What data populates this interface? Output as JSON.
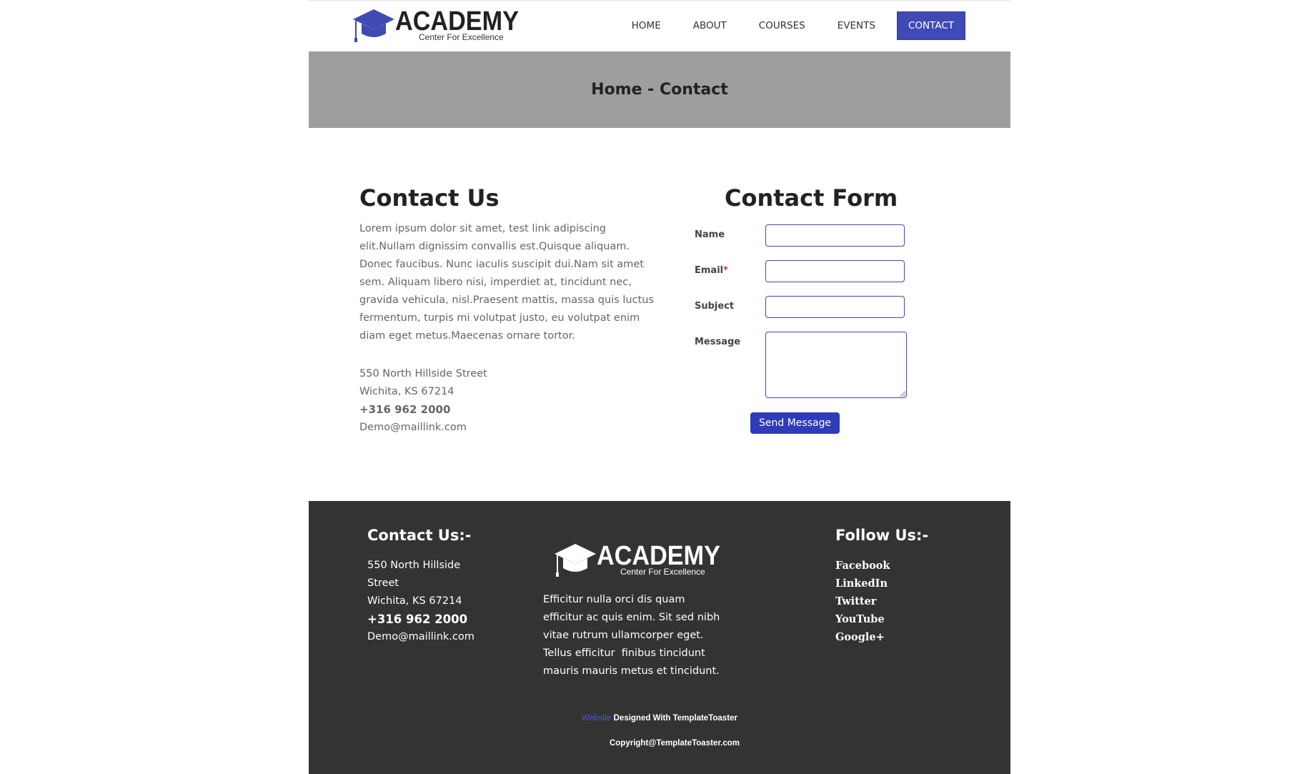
{
  "brand": {
    "name": "ACADEMY",
    "tagline": "Center For Excellence",
    "accent": "#3f4ab5"
  },
  "nav": {
    "items": [
      "HOME",
      "ABOUT",
      "COURSES",
      "EVENTS",
      "CONTACT"
    ],
    "active": "CONTACT"
  },
  "banner": {
    "title": "Home - Contact"
  },
  "contact_us": {
    "heading": "Contact Us",
    "lines": [
      "Lorem ipsum dolor sit amet, test link adipiscing",
      "elit.Nullam dignissim convallis est.Quisque aliquam.",
      "Donec faucibus. Nunc iaculis suscipit dui.Nam sit amet",
      "sem. Aliquam libero nisi, imperdiet at, tincidunt nec,",
      "gravida vehicula, nisl.Praesent mattis, massa quis luctus",
      "fermentum, turpis mi volutpat justo, eu volutpat enim",
      "diam eget metus.Maecenas ornare tortor."
    ],
    "address_line1": "550 North Hillside Street",
    "address_line2": "Wichita, KS 67214",
    "phone": "+316 962 2000",
    "email": "Demo@maillink.com"
  },
  "form": {
    "heading": "Contact Form",
    "name_label": "Name",
    "email_label": "Email",
    "email_required": "*",
    "subject_label": "Subject",
    "message_label": "Message",
    "name_value": "",
    "email_value": "",
    "subject_value": "",
    "message_value": "",
    "submit_label": "Send Message"
  },
  "footer": {
    "contact_heading": "Contact Us:-",
    "address_a": "550 North Hillside",
    "address_b": "Street",
    "address_c": "Wichita, KS 67214",
    "phone": "+316 962 2000",
    "email": "Demo@maillink.com",
    "desc_lines": [
      "Efficitur nulla orci dis quam",
      "efficitur ac quis enim. Sit sed nibh",
      "vitae rutrum ullamcorper eget.",
      "Tellus efficitur  finibus tincidunt",
      "mauris mauris metus et tincidunt."
    ],
    "follow_heading": "Follow Us:-",
    "social": [
      "Facebook",
      "LinkedIn",
      "Twitter",
      "YouTube",
      "Google+"
    ],
    "credit_link": "Website",
    "credit_text": " Designed With TemplateToaster",
    "copyright": "Copyright@TemplateToaster.com",
    "bg": "#333333"
  }
}
